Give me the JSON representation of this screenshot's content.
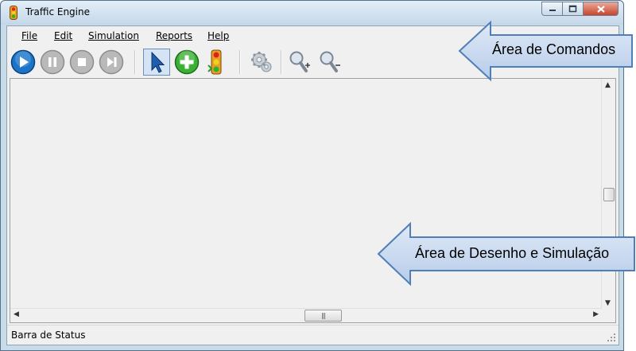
{
  "window": {
    "title": "Traffic Engine"
  },
  "menu": {
    "items": [
      "File",
      "Edit",
      "Simulation",
      "Reports",
      "Help"
    ]
  },
  "toolbar": {
    "buttons": [
      {
        "name": "play-icon"
      },
      {
        "name": "pause-icon"
      },
      {
        "name": "stop-icon"
      },
      {
        "name": "step-forward-icon"
      },
      {
        "name": "select-arrow-icon",
        "selected": true
      },
      {
        "name": "add-icon"
      },
      {
        "name": "traffic-light-icon"
      },
      {
        "name": "gears-icon"
      },
      {
        "name": "zoom-in-icon"
      },
      {
        "name": "zoom-out-icon"
      }
    ]
  },
  "status": {
    "text": "Barra de Status"
  },
  "annotations": {
    "commands": "Área de Comandos",
    "drawing": "Área de Desenho e Simulação"
  },
  "colors": {
    "callout_fill": "#c9dcf2",
    "callout_stroke": "#4f7fb8",
    "play_blue": "#1a74c8",
    "add_green": "#3cb034"
  }
}
